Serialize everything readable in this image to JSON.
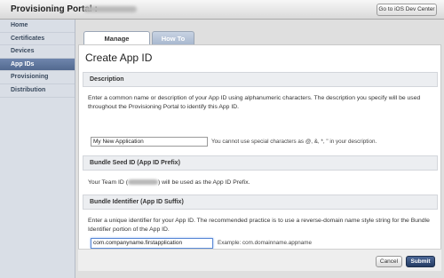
{
  "header": {
    "title": "Provisioning Portal :",
    "dev_center_button": "Go to iOS Dev Center"
  },
  "sidebar": {
    "items": [
      {
        "label": "Home"
      },
      {
        "label": "Certificates"
      },
      {
        "label": "Devices"
      },
      {
        "label": "App IDs"
      },
      {
        "label": "Provisioning"
      },
      {
        "label": "Distribution"
      }
    ]
  },
  "tabs": [
    {
      "label": "Manage"
    },
    {
      "label": "How To"
    }
  ],
  "page": {
    "title": "Create App ID"
  },
  "description_section": {
    "heading": "Description",
    "text": "Enter a common name or description of your App ID using alphanumeric characters. The description you specify will be used throughout the Provisioning Portal to identify this App ID.",
    "input_value": "My New Application",
    "hint": "You cannot use special characters as @, &, *, \" in your description."
  },
  "seed_section": {
    "heading": "Bundle Seed ID (App ID Prefix)",
    "text_before": "Your Team ID (",
    "text_after": ") will be used as the App ID Prefix."
  },
  "bundle_section": {
    "heading": "Bundle Identifier (App ID Suffix)",
    "text": "Enter a unique identifier for your App ID. The recommended practice is to use a reverse-domain name style string for the Bundle Identifier portion of the App ID.",
    "input_value": "com.companyname.firstapplication",
    "example": "Example: com.domainname.appname"
  },
  "footer": {
    "cancel": "Cancel",
    "submit": "Submit"
  }
}
